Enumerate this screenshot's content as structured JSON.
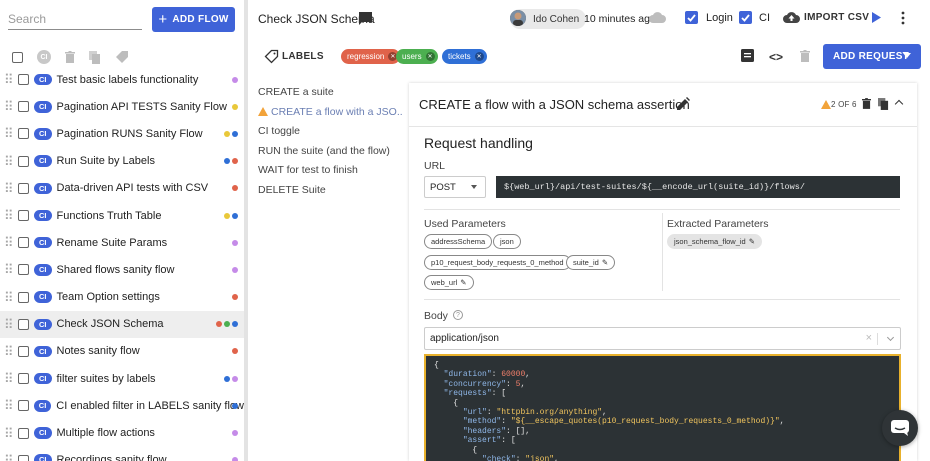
{
  "sidebar": {
    "search_placeholder": "Search",
    "add_flow_label": "ADD FLOW",
    "bulk_ci_label": "CI",
    "flows": [
      {
        "name": "Test basic labels functionality",
        "dots": [
          "#c58be8"
        ]
      },
      {
        "name": "Pagination API TESTS Sanity Flow",
        "dots": [
          "#e9c83a"
        ]
      },
      {
        "name": "Pagination RUNS Sanity Flow",
        "dots": [
          "#e9c83a",
          "#2f6fd6"
        ]
      },
      {
        "name": "Run Suite by Labels",
        "dots": [
          "#2f6fd6",
          "#e0634a"
        ]
      },
      {
        "name": "Data-driven API tests with CSV",
        "dots": [
          "#e0634a"
        ]
      },
      {
        "name": "Functions Truth Table",
        "dots": [
          "#e9c83a",
          "#2f6fd6"
        ]
      },
      {
        "name": "Rename Suite Params",
        "dots": [
          "#c58be8"
        ]
      },
      {
        "name": "Shared flows sanity flow",
        "dots": [
          "#c58be8"
        ]
      },
      {
        "name": "Team Option settings",
        "dots": [
          "#e0634a"
        ]
      },
      {
        "name": "Check JSON Schema",
        "dots": [
          "#e0634a",
          "#4caf50",
          "#2f6fd6"
        ],
        "selected": true
      },
      {
        "name": "Notes sanity flow",
        "dots": [
          "#e0634a"
        ]
      },
      {
        "name": "filter suites by labels",
        "dots": [
          "#2f6fd6",
          "#c58be8"
        ]
      },
      {
        "name": "CI enabled filter in LABELS sanity flow",
        "dots": [
          "#2f6fd6"
        ]
      },
      {
        "name": "Multiple flow actions",
        "dots": [
          "#c58be8"
        ]
      },
      {
        "name": "Recordings sanity flow",
        "dots": [
          "#c58be8"
        ]
      }
    ],
    "ci_badge": "CI"
  },
  "topbar": {
    "title": "Check JSON Schema",
    "user": "Ido Cohen",
    "time": "10 minutes ago",
    "login_label": "Login",
    "ci_label": "CI",
    "import_label": "IMPORT CSV"
  },
  "labels_bar": {
    "title": "LABELS",
    "labels": [
      {
        "name": "regression",
        "color": "#e0634a"
      },
      {
        "name": "users",
        "color": "#4caf50"
      },
      {
        "name": "tickets",
        "color": "#2f6fd6"
      }
    ],
    "add_request_label": "ADD REQUEST"
  },
  "steps": [
    {
      "label": "CREATE a suite"
    },
    {
      "label": "CREATE a flow with a JSO...",
      "active": true
    },
    {
      "label": "CI toggle"
    },
    {
      "label": "RUN the suite (and the flow)"
    },
    {
      "label": "WAIT for test to finish"
    },
    {
      "label": "DELETE Suite"
    }
  ],
  "request": {
    "title": "CREATE a flow with a JSON schema assertion",
    "position": "2 OF 6",
    "section_title": "Request handling",
    "url_label": "URL",
    "method": "POST",
    "url": "${web_url}/api/test-suites/${__encode_url(suite_id)}/flows/",
    "used_params_label": "Used Parameters",
    "extracted_params_label": "Extracted Parameters",
    "used_params": [
      "addressSchema",
      "json",
      "p10_request_body_requests_0_method",
      "suite_id",
      "web_url"
    ],
    "extracted_params": [
      "json_schema_flow_id"
    ],
    "body_label": "Body",
    "content_type": "application/json",
    "body_lines": [
      "{",
      "  \"duration\": 60000,",
      "  \"concurrency\": 5,",
      "  \"requests\": [",
      "    {",
      "      \"url\": \"httpbin.org/anything\",",
      "      \"method\": \"${__escape_quotes(p10_request_body_requests_0_method)}\",",
      "      \"headers\": [],",
      "      \"assert\": [",
      "        {",
      "          \"check\": \"json\","
    ]
  }
}
